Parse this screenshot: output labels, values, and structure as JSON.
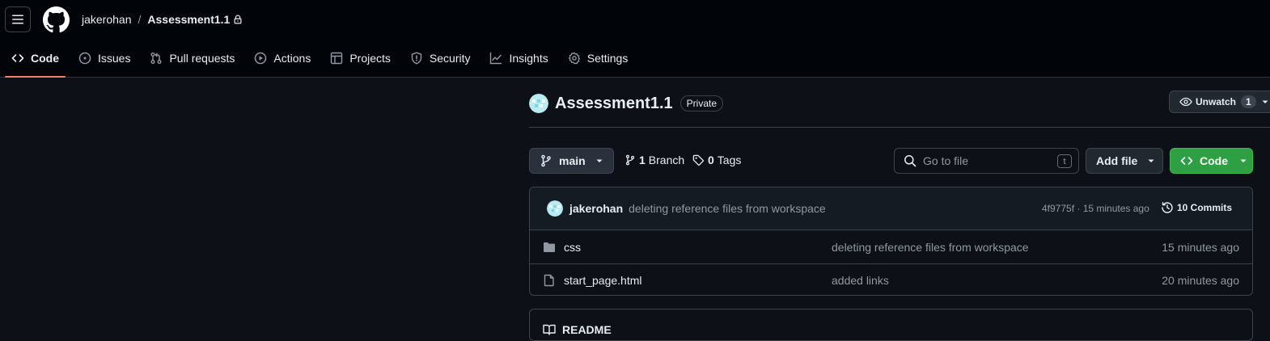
{
  "header": {
    "owner": "jakerohan",
    "separator": "/",
    "repo": "Assessment1.1"
  },
  "tabs": [
    {
      "label": "Code",
      "icon": "code-icon",
      "active": true
    },
    {
      "label": "Issues",
      "icon": "issue-icon"
    },
    {
      "label": "Pull requests",
      "icon": "pull-request-icon"
    },
    {
      "label": "Actions",
      "icon": "play-icon"
    },
    {
      "label": "Projects",
      "icon": "table-icon"
    },
    {
      "label": "Security",
      "icon": "shield-icon"
    },
    {
      "label": "Insights",
      "icon": "graph-icon"
    },
    {
      "label": "Settings",
      "icon": "gear-icon"
    }
  ],
  "repo_header": {
    "name": "Assessment1.1",
    "visibility": "Private",
    "watch_label": "Unwatch",
    "watch_count": "1"
  },
  "toolbar": {
    "branch": "main",
    "branch_count": "1",
    "branch_label": "Branch",
    "tag_count": "0",
    "tag_label": "Tags",
    "search_placeholder": "Go to file",
    "search_shortcut": "t",
    "add_file_label": "Add file",
    "code_label": "Code"
  },
  "latest_commit": {
    "author": "jakerohan",
    "message": "deleting reference files from workspace",
    "meta": "4f9775f · 15 minutes ago",
    "commits_count": "10 Commits"
  },
  "files": [
    {
      "name": "css",
      "type": "folder",
      "commit": "deleting reference files from workspace",
      "age": "15 minutes ago"
    },
    {
      "name": "start_page.html",
      "type": "file",
      "commit": "added links",
      "age": "20 minutes ago"
    }
  ],
  "readme": {
    "label": "README"
  },
  "colors": {
    "header_bg": "#010409",
    "page_bg": "#0d1117",
    "code_button": "#2ea043",
    "active_tab_underline": "#f78166"
  }
}
